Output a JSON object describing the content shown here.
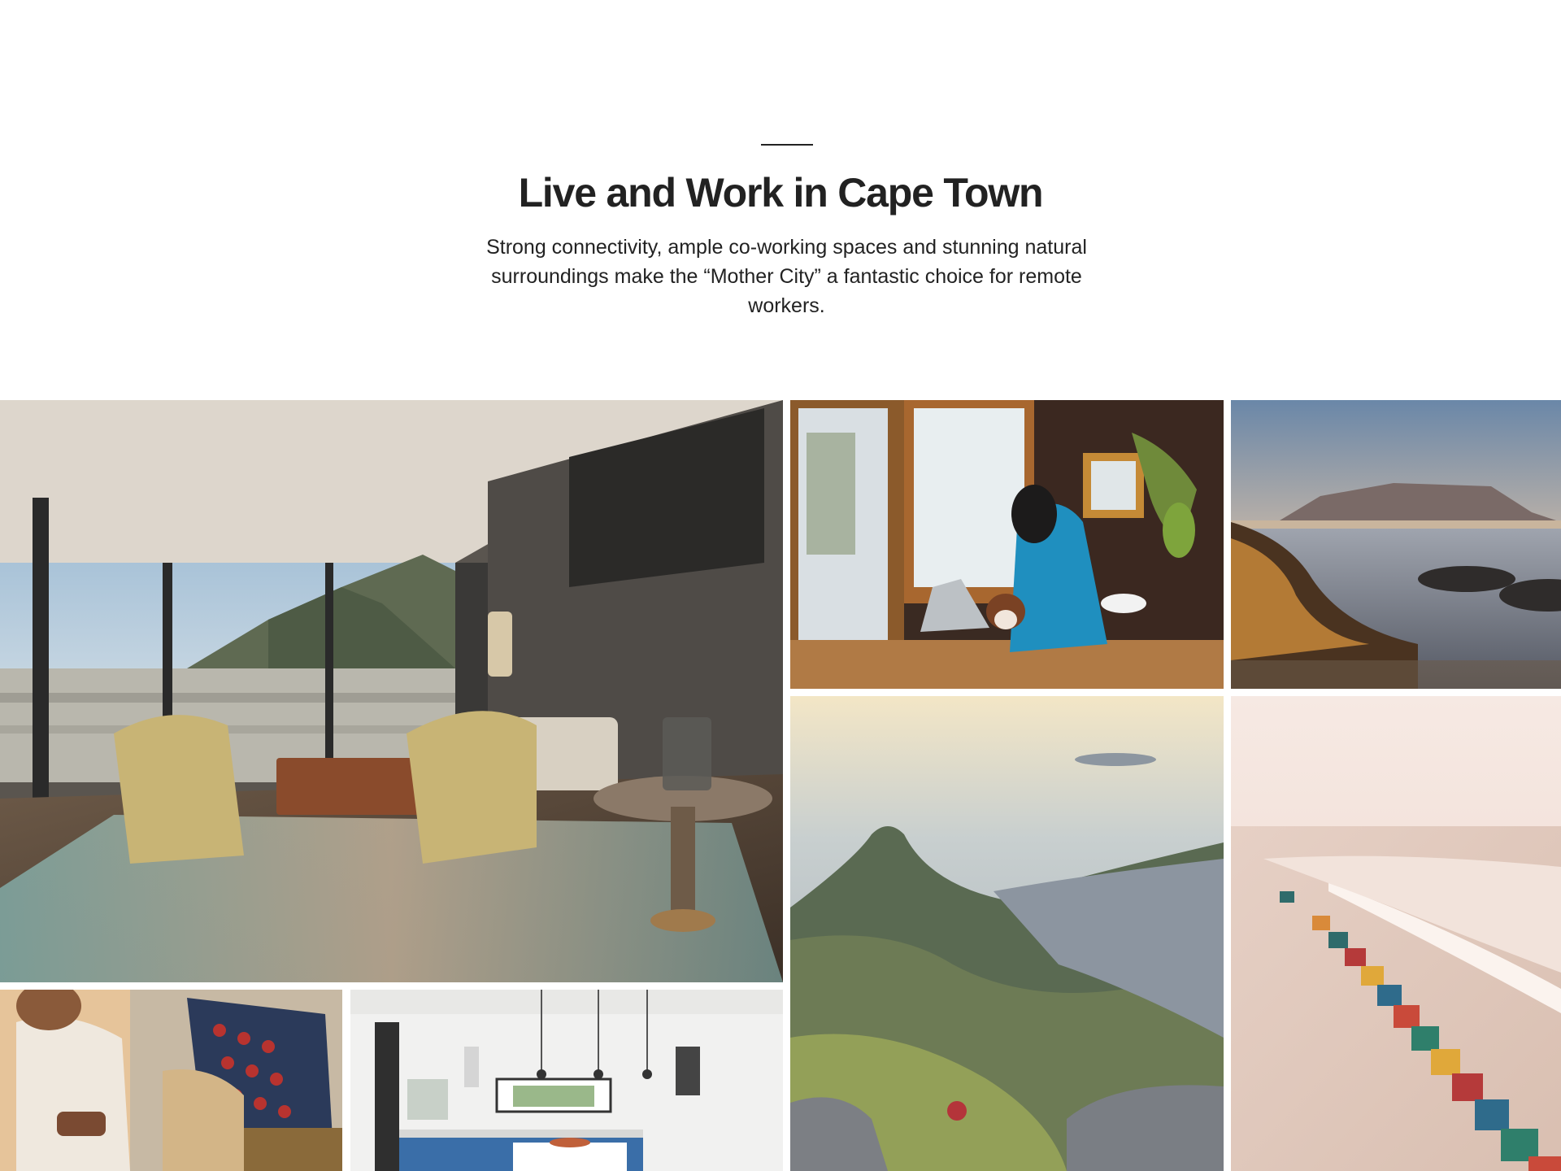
{
  "hero": {
    "title": "Live and Work in Cape Town",
    "subtitle": "Strong connectivity, ample co-working spaces and stunning natural surroundings make the “Mother City” a fantastic choice for remote workers."
  },
  "gallery": {
    "photos": [
      {
        "subject": "living-room-with-mountain-view"
      },
      {
        "subject": "woman-working-on-laptop-with-dog"
      },
      {
        "subject": "table-mountain-from-beach"
      },
      {
        "subject": "lions-head-aerial-view"
      },
      {
        "subject": "muizenberg-beach-huts"
      },
      {
        "subject": "woman-using-phone-on-sofa"
      },
      {
        "subject": "white-kitchen-interior"
      }
    ]
  },
  "colors": {
    "text": "#222222",
    "background": "#ffffff"
  }
}
